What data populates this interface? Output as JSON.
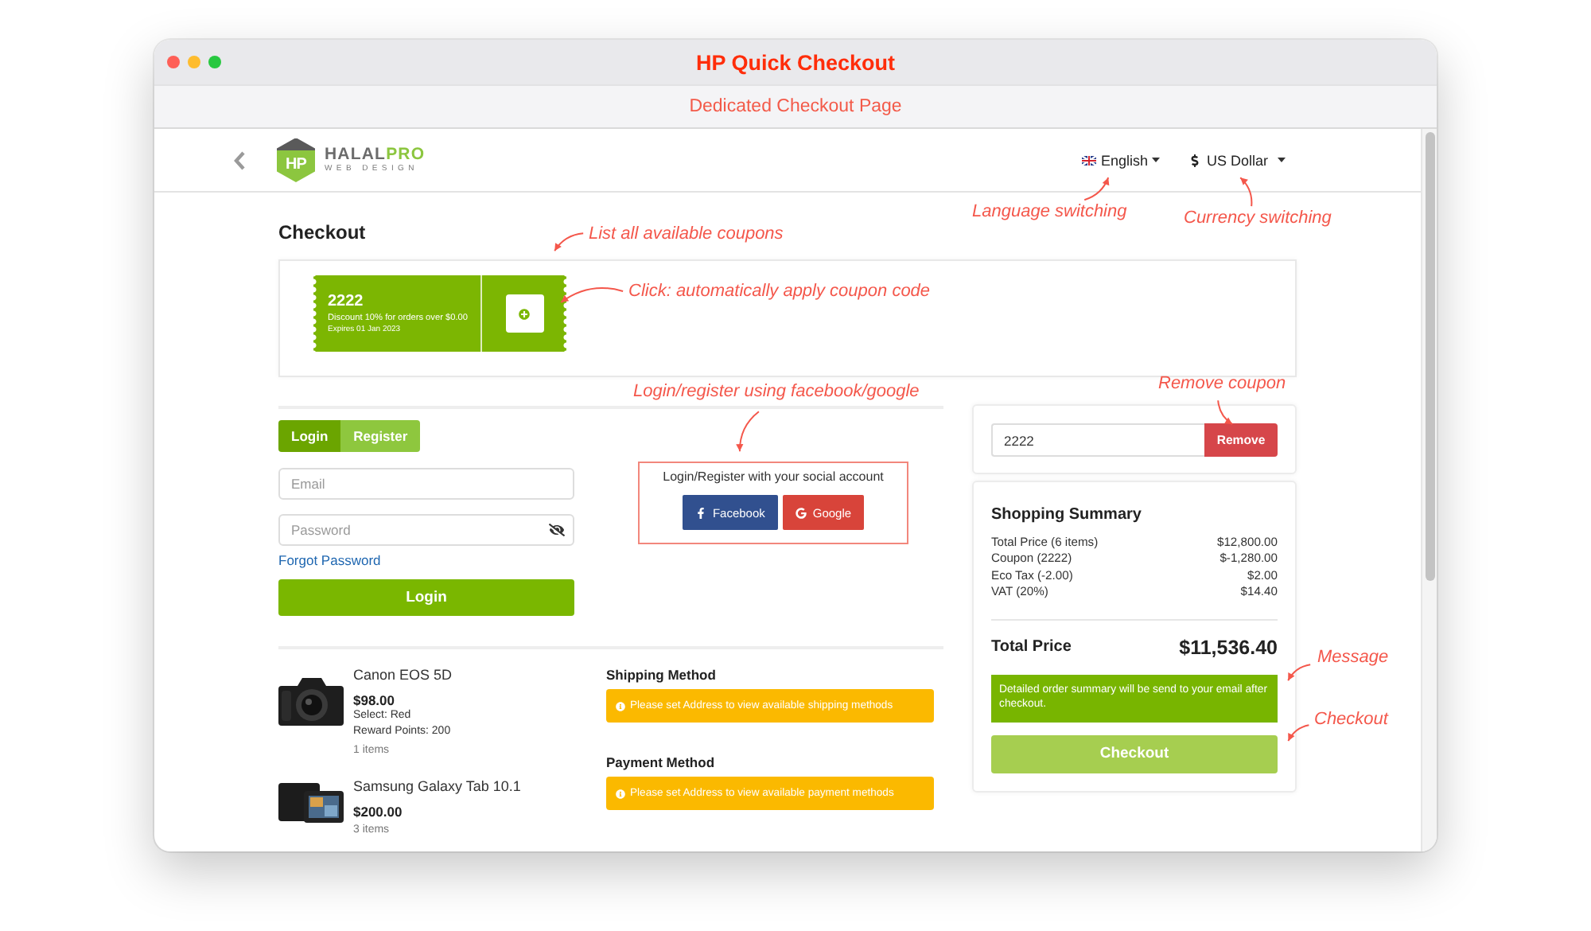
{
  "window": {
    "title": "HP Quick Checkout",
    "subtitle": "Dedicated Checkout Page"
  },
  "header": {
    "logo": {
      "mark": "HP",
      "name": "HALAL",
      "accent": "PRO",
      "tagline": "WEB DESIGN"
    },
    "language": "English",
    "currency": "US Dollar"
  },
  "checkout": {
    "title": "Checkout",
    "coupons": [
      {
        "code": "2222",
        "description": "Discount 10% for orders over $0.00",
        "expires": "Expires 01 Jan 2023"
      }
    ]
  },
  "auth": {
    "tabs": [
      {
        "label": "Login",
        "selected": true
      },
      {
        "label": "Register",
        "selected": false
      }
    ],
    "fields": [
      {
        "kind": "email",
        "placeholder": "Email"
      },
      {
        "kind": "password",
        "placeholder": "Password"
      }
    ],
    "forgot_link": "Forgot Password",
    "submit": "Login"
  },
  "social": {
    "prompt": "Login/Register with your social account",
    "buttons": [
      {
        "kind": "facebook",
        "label": "Facebook"
      },
      {
        "kind": "google",
        "label": "Google"
      }
    ]
  },
  "cart": [
    {
      "kind": "camera",
      "name": "Canon EOS 5D",
      "price": "$98.00",
      "options": [
        "Select: Red",
        "Reward Points: 200"
      ],
      "quantity": "1 items"
    },
    {
      "kind": "tablet",
      "name": "Samsung Galaxy Tab 10.1",
      "price": "$200.00",
      "quantity": "3 items"
    }
  ],
  "methods": [
    {
      "title": "Shipping Method",
      "alert": "Please set Address to view available shipping methods"
    },
    {
      "title": "Payment Method",
      "alert": "Please set Address to view available payment methods"
    }
  ],
  "coupon_field": {
    "value": "2222",
    "button": "Remove"
  },
  "summary": {
    "title": "Shopping Summary",
    "rows": [
      {
        "label": "Total Price (6 items)",
        "value": "$12,800.00"
      },
      {
        "label": "Coupon (2222)",
        "value": "$-1,280.00"
      },
      {
        "label": "Eco Tax (-2.00)",
        "value": "$2.00"
      },
      {
        "label": "VAT (20%)",
        "value": "$14.40"
      }
    ],
    "total_label": "Total Price",
    "total_value": "$11,536.40",
    "message": "Detailed order summary will be send to your email after checkout.",
    "button": "Checkout"
  },
  "annotations": [
    "Language switching",
    "Currency switching",
    "List all available coupons",
    "Click: automatically apply coupon code",
    "Remove coupon",
    "Login/register using facebook/google",
    "Message",
    "Checkout"
  ]
}
